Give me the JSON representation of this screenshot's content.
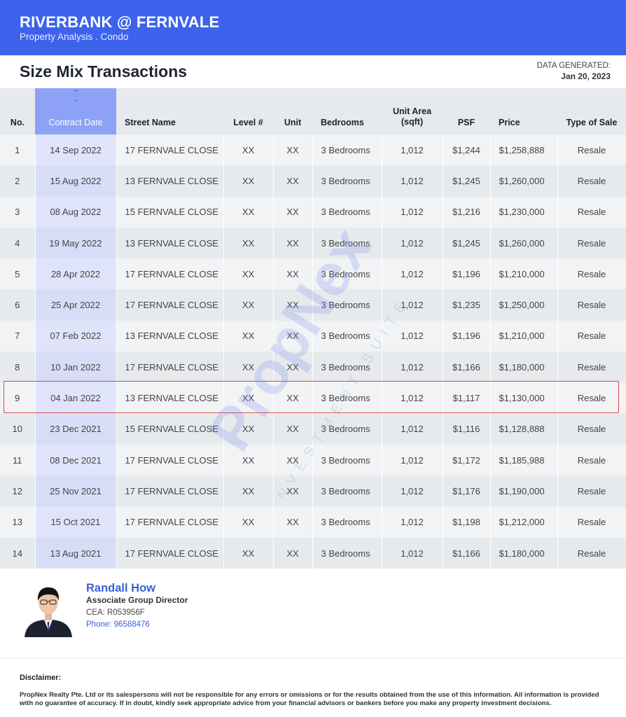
{
  "header": {
    "title": "RIVERBANK @ FERNVALE",
    "subtitle": "Property Analysis . Condo"
  },
  "page": {
    "title": "Size Mix Transactions",
    "generated_label": "DATA GENERATED:",
    "generated_date": "Jan 20, 2023"
  },
  "table": {
    "columns": [
      {
        "key": "no",
        "label": "No."
      },
      {
        "key": "date",
        "label": "Contract Date"
      },
      {
        "key": "street",
        "label": "Street Name"
      },
      {
        "key": "level",
        "label": "Level #"
      },
      {
        "key": "unit",
        "label": "Unit"
      },
      {
        "key": "bed",
        "label": "Bedrooms"
      },
      {
        "key": "area",
        "label": "Unit Area (sqft)"
      },
      {
        "key": "psf",
        "label": "PSF"
      },
      {
        "key": "price",
        "label": "Price"
      },
      {
        "key": "type",
        "label": "Type of Sale"
      }
    ],
    "sorted_column": "date",
    "highlighted_row": 9,
    "rows": [
      [
        "1",
        "14 Sep 2022",
        "17 FERNVALE CLOSE",
        "XX",
        "XX",
        "3 Bedrooms",
        "1,012",
        "$1,244",
        "$1,258,888",
        "Resale"
      ],
      [
        "2",
        "15 Aug 2022",
        "13 FERNVALE CLOSE",
        "XX",
        "XX",
        "3 Bedrooms",
        "1,012",
        "$1,245",
        "$1,260,000",
        "Resale"
      ],
      [
        "3",
        "08 Aug 2022",
        "15 FERNVALE CLOSE",
        "XX",
        "XX",
        "3 Bedrooms",
        "1,012",
        "$1,216",
        "$1,230,000",
        "Resale"
      ],
      [
        "4",
        "19 May 2022",
        "13 FERNVALE CLOSE",
        "XX",
        "XX",
        "3 Bedrooms",
        "1,012",
        "$1,245",
        "$1,260,000",
        "Resale"
      ],
      [
        "5",
        "28 Apr 2022",
        "17 FERNVALE CLOSE",
        "XX",
        "XX",
        "3 Bedrooms",
        "1,012",
        "$1,196",
        "$1,210,000",
        "Resale"
      ],
      [
        "6",
        "25 Apr 2022",
        "17 FERNVALE CLOSE",
        "XX",
        "XX",
        "3 Bedrooms",
        "1,012",
        "$1,235",
        "$1,250,000",
        "Resale"
      ],
      [
        "7",
        "07 Feb 2022",
        "13 FERNVALE CLOSE",
        "XX",
        "XX",
        "3 Bedrooms",
        "1,012",
        "$1,196",
        "$1,210,000",
        "Resale"
      ],
      [
        "8",
        "10 Jan 2022",
        "17 FERNVALE CLOSE",
        "XX",
        "XX",
        "3 Bedrooms",
        "1,012",
        "$1,166",
        "$1,180,000",
        "Resale"
      ],
      [
        "9",
        "04 Jan 2022",
        "13 FERNVALE CLOSE",
        "XX",
        "XX",
        "3 Bedrooms",
        "1,012",
        "$1,117",
        "$1,130,000",
        "Resale"
      ],
      [
        "10",
        "23 Dec 2021",
        "15 FERNVALE CLOSE",
        "XX",
        "XX",
        "3 Bedrooms",
        "1,012",
        "$1,116",
        "$1,128,888",
        "Resale"
      ],
      [
        "11",
        "08 Dec 2021",
        "17 FERNVALE CLOSE",
        "XX",
        "XX",
        "3 Bedrooms",
        "1,012",
        "$1,172",
        "$1,185,988",
        "Resale"
      ],
      [
        "12",
        "25 Nov 2021",
        "17 FERNVALE CLOSE",
        "XX",
        "XX",
        "3 Bedrooms",
        "1,012",
        "$1,176",
        "$1,190,000",
        "Resale"
      ],
      [
        "13",
        "15 Oct 2021",
        "17 FERNVALE CLOSE",
        "XX",
        "XX",
        "3 Bedrooms",
        "1,012",
        "$1,198",
        "$1,212,000",
        "Resale"
      ],
      [
        "14",
        "13 Aug 2021",
        "17 FERNVALE CLOSE",
        "XX",
        "XX",
        "3 Bedrooms",
        "1,012",
        "$1,166",
        "$1,180,000",
        "Resale"
      ]
    ]
  },
  "watermark": {
    "brand": "PropNex",
    "tagline": "INVESTMENT SUITE"
  },
  "agent": {
    "name": "Randall How",
    "role": "Associate Group Director",
    "cea": "CEA: R053956F",
    "phone_label": "Phone: ",
    "phone": "96588476"
  },
  "disclaimer": {
    "title": "Disclaimer:",
    "text": "PropNex Realty Pte.  Ltd or its salespersons will not be responsible for any errors or omissions or for the results obtained from the use of this information. All information is provided with no guarantee of accuracy. If in doubt, kindly seek appropriate advice from your financial advisors or bankers before you make any property investment decisions."
  },
  "colors": {
    "brand_blue": "#3d63ec",
    "sorted_header": "#8da2f6",
    "highlight_border": "#d94a4a"
  }
}
